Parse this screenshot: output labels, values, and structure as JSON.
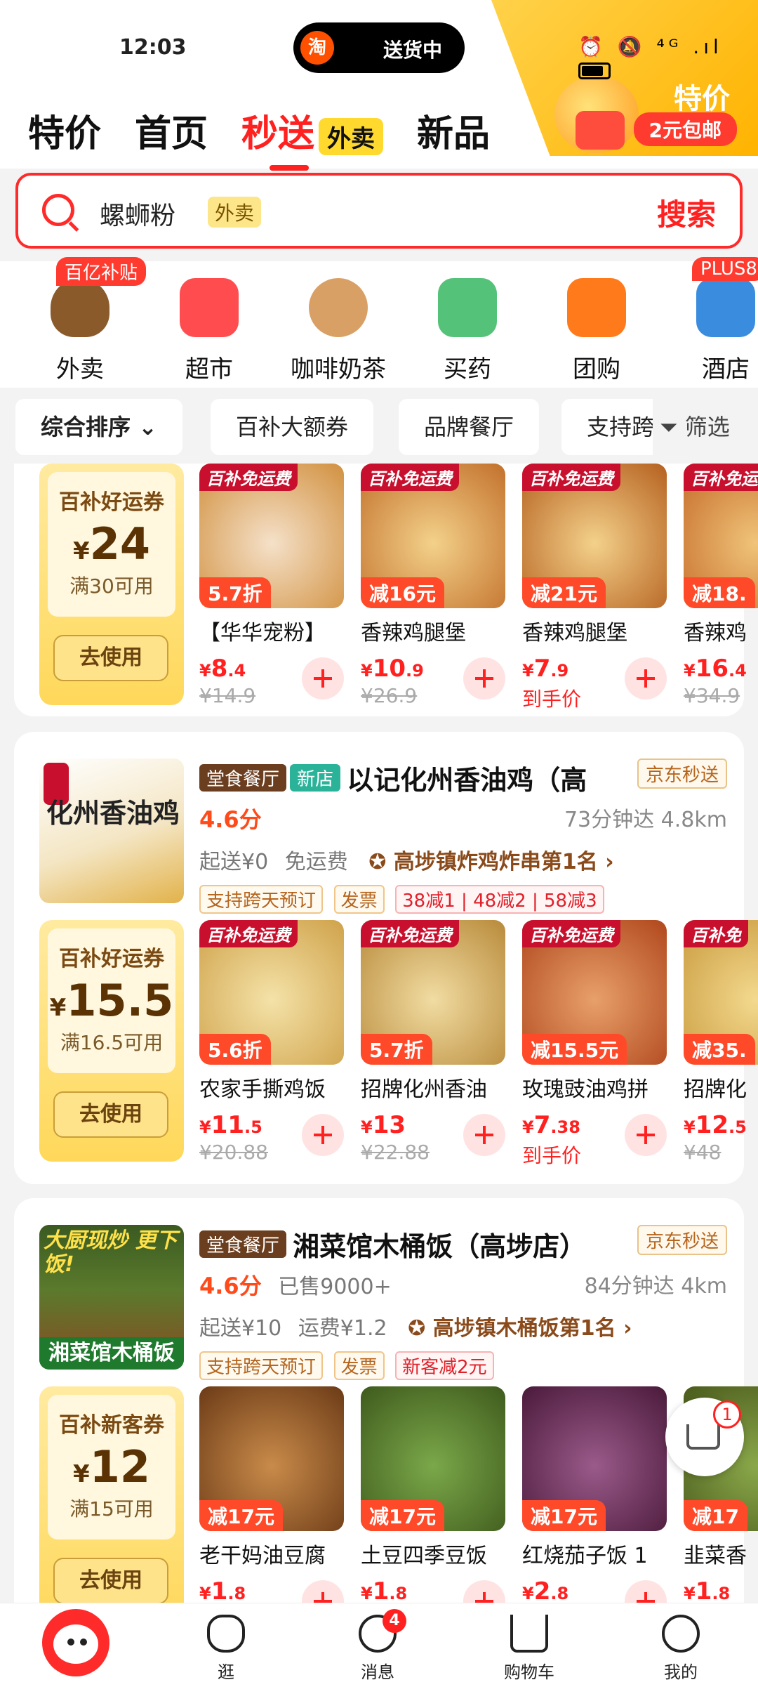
{
  "status": {
    "time": "12:03",
    "pill_logo": "淘",
    "pill_text": "送货中",
    "icons": "⏰ 🔕 ⁴ᴳ .ıl"
  },
  "promo": {
    "title": "特价",
    "pill": "2元包邮"
  },
  "nav": [
    {
      "label": "特价"
    },
    {
      "label": "首页"
    },
    {
      "label": "秒送",
      "tag": "外卖",
      "active": true
    },
    {
      "label": "新品"
    }
  ],
  "search": {
    "value": "螺蛳粉",
    "tag": "外卖",
    "button": "搜索"
  },
  "categories": [
    {
      "label": "外卖",
      "badge": "百亿补贴",
      "color": "#8b5a2b"
    },
    {
      "label": "超市",
      "color": "#ff4d4f"
    },
    {
      "label": "咖啡奶茶",
      "color": "#d9a066"
    },
    {
      "label": "买药",
      "color": "#55c27a"
    },
    {
      "label": "团购",
      "color": "#ff7a1a"
    },
    {
      "label": "酒店",
      "badge": "PLUS8",
      "color": "#3a8dde"
    }
  ],
  "filters": [
    {
      "label": "综合排序 ⌄",
      "bold": true
    },
    {
      "label": "百补大额券"
    },
    {
      "label": "品牌餐厅"
    },
    {
      "label": "支持跨"
    }
  ],
  "filter_button": "筛选",
  "shops": [
    {
      "coupon": {
        "title": "百补好运券",
        "amount": "24",
        "cond": "满30可用",
        "btn": "去使用"
      },
      "dishes": [
        {
          "ribbon": "百补免运费",
          "disc": "5.7折",
          "name": "【华华宠粉】",
          "price": "8",
          "cents": ".4",
          "old": "¥14.9",
          "c1": "#f5e1c9",
          "c2": "#d1903f"
        },
        {
          "ribbon": "百补免运费",
          "disc": "减16元",
          "name": "香辣鸡腿堡",
          "price": "10",
          "cents": ".9",
          "old": "¥26.9",
          "c1": "#f3d18a",
          "c2": "#c2702b"
        },
        {
          "ribbon": "百补免运费",
          "disc": "减21元",
          "name": "香辣鸡腿堡",
          "price": "7",
          "cents": ".9",
          "hand": "到手价",
          "c1": "#f3d18a",
          "c2": "#b5601f"
        },
        {
          "ribbon": "百补免运费",
          "disc": "减18.",
          "name": "香辣鸡",
          "price": "16",
          "cents": ".4",
          "old": "¥34.9",
          "c1": "#f0c47a",
          "c2": "#c46a28"
        }
      ]
    },
    {
      "name": "以记化州香油鸡（高",
      "tags": [
        "堂食餐厅",
        "新店"
      ],
      "jd": "京东秒送",
      "score": "4.6分",
      "sold": "",
      "eta": "73分钟达  4.8km",
      "min": "起送¥0",
      "fee": "免运费",
      "rank": "高埗镇炸鸡炸串第1名 ›",
      "promos": [
        "支持跨天预订",
        "发票"
      ],
      "red_promos": [
        "38减1",
        "48减2",
        "58减3"
      ],
      "img_text": "化州香油鸡",
      "coupon": {
        "title": "百补好运券",
        "amount": "15.5",
        "cond": "满16.5可用",
        "btn": "去使用"
      },
      "dishes": [
        {
          "ribbon": "百补免运费",
          "disc": "5.6折",
          "name": "农家手撕鸡饭",
          "price": "11",
          "cents": ".5",
          "old": "¥20.88",
          "c1": "#f4e2a8",
          "c2": "#cfa24a"
        },
        {
          "ribbon": "百补免运费",
          "disc": "5.7折",
          "name": "招牌化州香油",
          "price": "13",
          "cents": "",
          "old": "¥22.88",
          "c1": "#f1dca2",
          "c2": "#b88a3a"
        },
        {
          "ribbon": "百补免运费",
          "disc": "减15.5元",
          "name": "玫瑰豉油鸡拼",
          "price": "7",
          "cents": ".38",
          "hand": "到手价",
          "c1": "#e8a06a",
          "c2": "#b0471c"
        },
        {
          "ribbon": "百补免",
          "disc": "减35.",
          "name": "招牌化",
          "price": "12",
          "cents": ".5",
          "old": "¥48",
          "c1": "#f3d98e",
          "c2": "#c99a3e"
        }
      ]
    },
    {
      "name": "湘菜馆木桶饭（高埗店）",
      "tags": [
        "堂食餐厅"
      ],
      "jd": "京东秒送",
      "score": "4.6分",
      "sold": "已售9000+",
      "eta": "84分钟达  4km",
      "min": "起送¥10",
      "fee": "运费¥1.2",
      "rank": "高埗镇木桶饭第1名 ›",
      "promos": [
        "支持跨天预订",
        "发票"
      ],
      "red_promos": [
        "新客减2元"
      ],
      "img_text": "湘菜馆木桶饭",
      "img_top": "大厨现炒 更下饭!",
      "coupon": {
        "title": "百补新客券",
        "amount": "12",
        "cond": "满15可用",
        "btn": "去使用"
      },
      "dishes": [
        {
          "disc": "减17元",
          "name": "老干妈油豆腐",
          "price": "1",
          "cents": ".8",
          "c1": "#c98b4a",
          "c2": "#6b3a16"
        },
        {
          "disc": "减17元",
          "name": "土豆四季豆饭",
          "price": "1",
          "cents": ".8",
          "c1": "#7ba84a",
          "c2": "#3e5a1c"
        },
        {
          "disc": "减17元",
          "name": "红烧茄子饭 1",
          "price": "2",
          "cents": ".8",
          "c1": "#9a5a8a",
          "c2": "#4a1a3a"
        },
        {
          "disc": "减17",
          "name": "韭菜香",
          "price": "1",
          "cents": ".8",
          "c1": "#8aa84a",
          "c2": "#4a5a1c"
        }
      ]
    }
  ],
  "float_cart": {
    "count": "1"
  },
  "tabbar": [
    {
      "label": "逛"
    },
    {
      "label": "消息",
      "badge": "4"
    },
    {
      "label": "购物车"
    },
    {
      "label": "我的"
    }
  ]
}
